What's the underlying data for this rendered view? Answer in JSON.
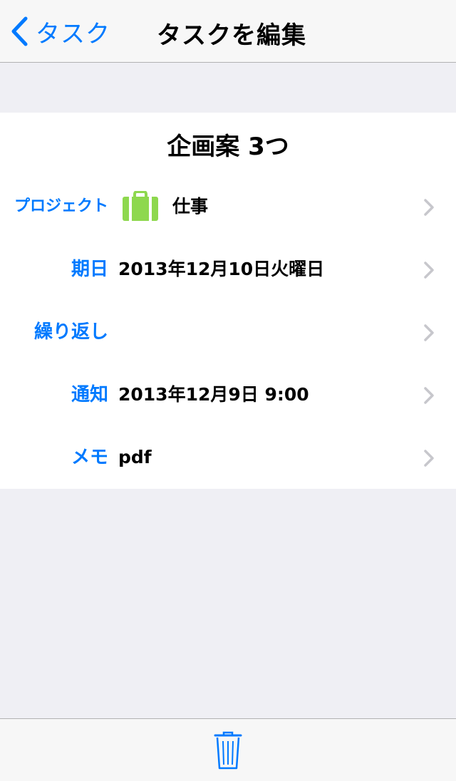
{
  "navbar": {
    "back_label": "タスク",
    "title": "タスクを編集"
  },
  "task": {
    "title": "企画案 3つ",
    "rows": [
      {
        "label": "プロジェクト",
        "value": "仕事",
        "icon": "briefcase-icon"
      },
      {
        "label": "期日",
        "value": "2013年12月10日火曜日"
      },
      {
        "label": "繰り返し",
        "value": ""
      },
      {
        "label": "通知",
        "value": "2013年12月9日 9:00"
      },
      {
        "label": "メモ",
        "value": "pdf"
      }
    ]
  },
  "toolbar": {
    "icon": "trash-icon"
  },
  "colors": {
    "accent": "#007aff",
    "project": "#8ed84e",
    "chevron": "#c7c7cc",
    "background": "#efeff4"
  }
}
